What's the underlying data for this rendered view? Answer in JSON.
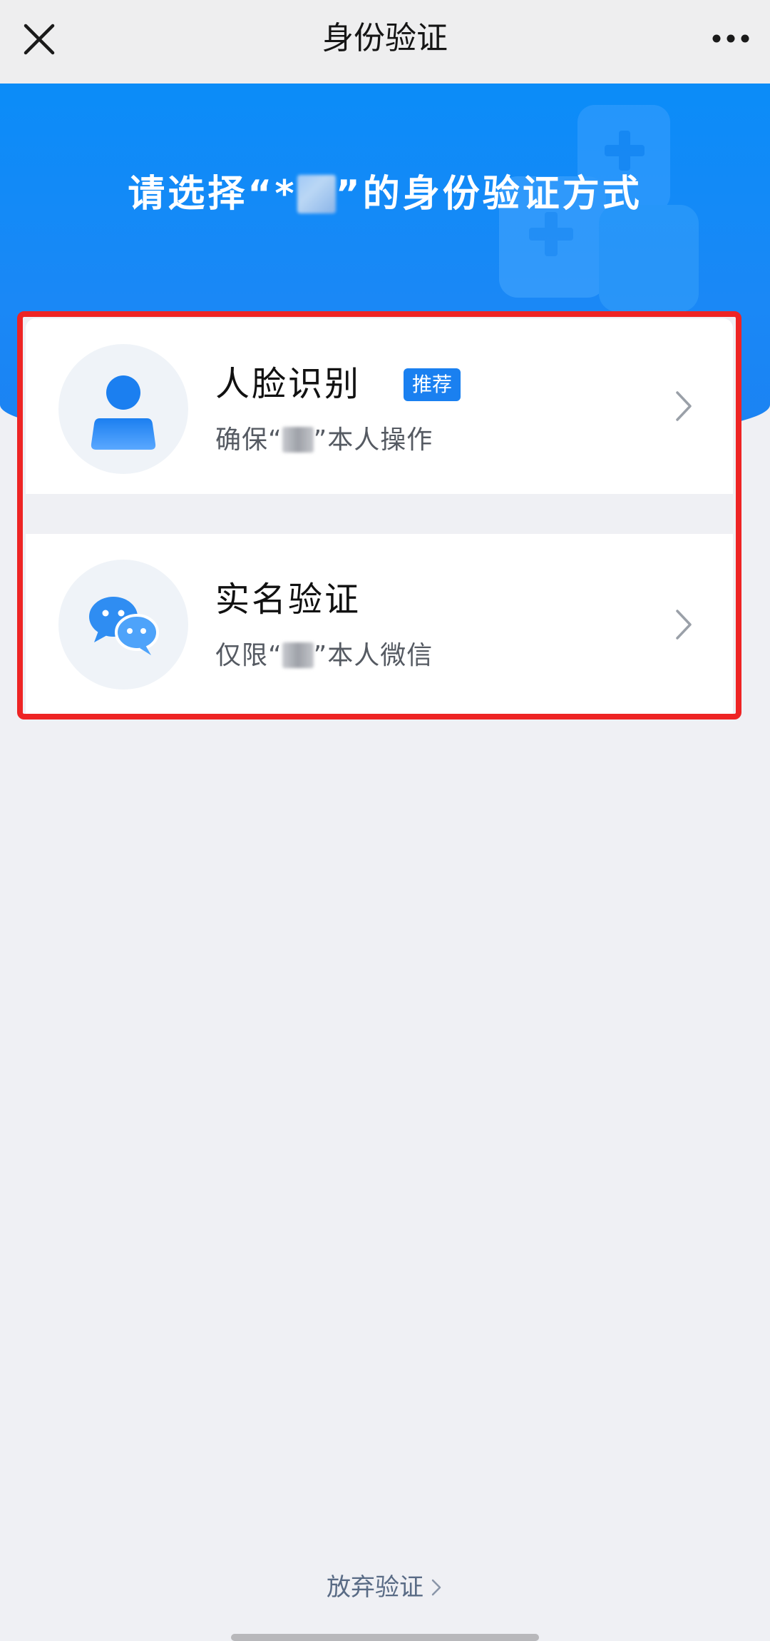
{
  "navbar": {
    "title": "身份验证",
    "close_icon": "close-icon",
    "more_icon": "more-icon"
  },
  "hero": {
    "prefix": "请选择“*",
    "suffix": "”的身份验证方式"
  },
  "options": [
    {
      "title": "人脸识别",
      "badge": "推荐",
      "sub_prefix": "确保“",
      "sub_suffix": "”本人操作",
      "icon": "user-icon"
    },
    {
      "title": "实名验证",
      "sub_prefix": "仅限“",
      "sub_suffix": "”本人微信",
      "icon": "wechat-icon"
    }
  ],
  "footer": {
    "giveup_label": "放弃验证"
  },
  "colors": {
    "primary": "#1a80f0",
    "highlight_border": "#ee2424",
    "background": "#eff0f4"
  }
}
